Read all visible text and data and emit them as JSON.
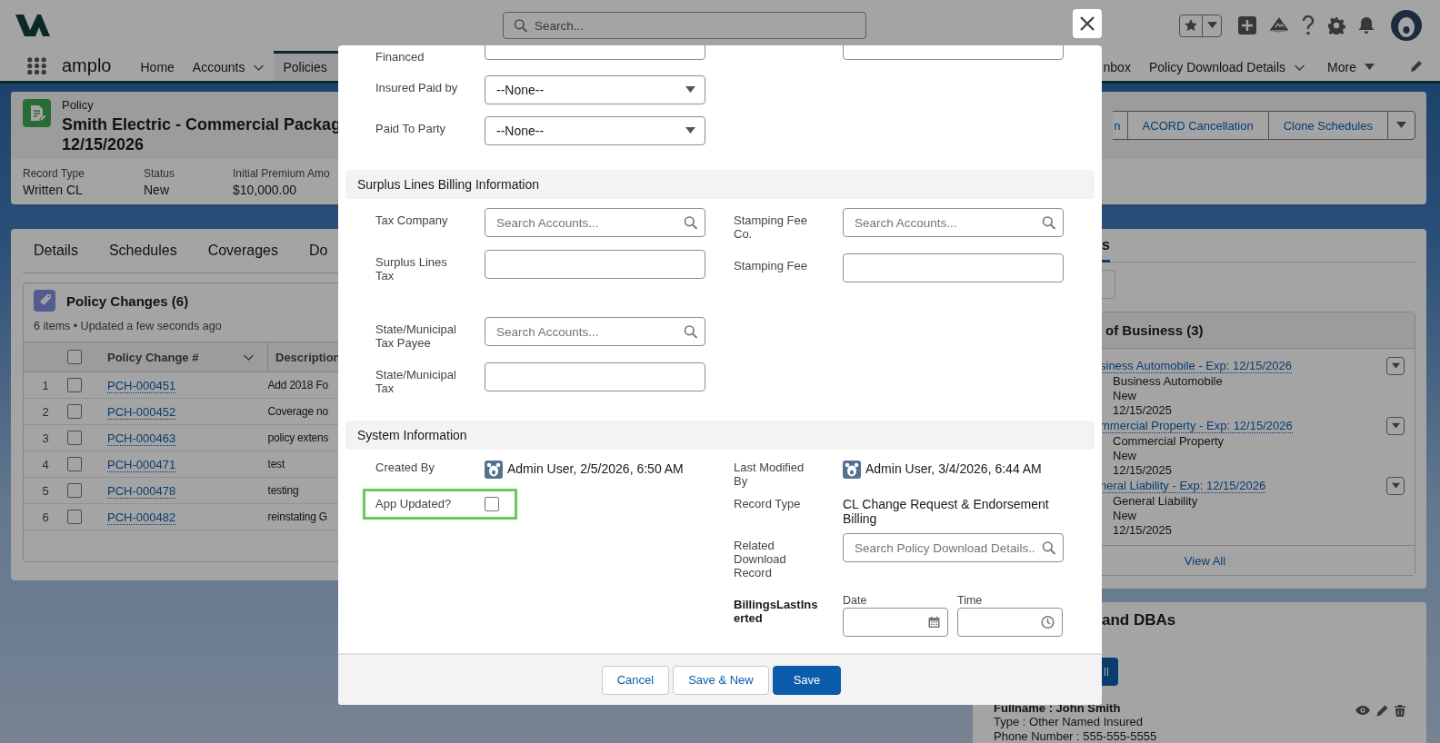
{
  "header": {
    "search_placeholder": "Search..."
  },
  "nav": {
    "app_name": "amplo",
    "items": [
      {
        "label": "Home",
        "kind": "plain",
        "selected": false
      },
      {
        "label": "Accounts",
        "kind": "chevron",
        "selected": false
      },
      {
        "label": "Policies",
        "kind": "plain",
        "selected": true
      }
    ],
    "items_right": [
      {
        "label": "nbox",
        "kind": "plain",
        "selected": false
      },
      {
        "label": "Policy Download Details",
        "kind": "chevron",
        "selected": false
      },
      {
        "label": "More",
        "kind": "triangle",
        "selected": false
      }
    ]
  },
  "record": {
    "object_label": "Policy",
    "title": "Smith Electric - Commercial Packag",
    "date": "12/15/2026",
    "actions": [
      "n",
      "ACORD Cancellation",
      "Clone Schedules"
    ],
    "fields": [
      {
        "label": "Record Type",
        "value": "Written CL"
      },
      {
        "label": "Status",
        "value": "New"
      },
      {
        "label": "Initial Premium Amo",
        "value": "$10,000.00"
      }
    ]
  },
  "tabs": [
    "Details",
    "Schedules",
    "Coverages",
    "Do"
  ],
  "related": {
    "title": "Policy Changes (6)",
    "meta": "6 items • Updated a few seconds ago",
    "all_selected": false,
    "columns": [
      {
        "label": "Policy Change #",
        "menu": true
      },
      {
        "label": "Description"
      }
    ],
    "rows": [
      {
        "number": "1",
        "id": "PCH-000451",
        "description": "Add 2018 Fo",
        "selected": false
      },
      {
        "number": "2",
        "id": "PCH-000452",
        "description": "Coverage no",
        "selected": false
      },
      {
        "number": "3",
        "id": "PCH-000463",
        "description": "policy extens",
        "selected": false
      },
      {
        "number": "4",
        "id": "PCH-000471",
        "description": "test",
        "selected": false
      },
      {
        "number": "5",
        "id": "PCH-000478",
        "description": "testing",
        "selected": false
      },
      {
        "number": "6",
        "id": "PCH-000482",
        "description": "reinstating G",
        "selected": false
      }
    ]
  },
  "side": {
    "tabs": [
      {
        "label": "s",
        "selected": true
      }
    ],
    "lines": {
      "title": "of Business (3)",
      "footer_link": "View All",
      "items": [
        {
          "link": "siness Automobile - Exp: 12/15/2026",
          "details": [
            "Business Automobile",
            "New",
            "12/15/2025"
          ]
        },
        {
          "link": "mmercial Property - Exp: 12/15/2026",
          "details": [
            "Commercial Property",
            "New",
            "12/15/2025"
          ]
        },
        {
          "link": "neral Liability - Exp: 12/15/2026",
          "details": [
            "General Liability",
            "New",
            "12/15/2025"
          ]
        }
      ]
    },
    "dbas": {
      "title": "and DBAs",
      "button": "ll",
      "contacts": [
        {
          "name": "Fullname : John Smith",
          "lines": [
            "Type : Other Named Insured",
            "Phone Number : 555-555-5555"
          ]
        }
      ]
    }
  },
  "modal": {
    "sections": [
      {
        "left": [
          {
            "label": "Financed",
            "kind": "text"
          },
          {
            "label": "Insured Paid by",
            "kind": "select",
            "value": "--None--"
          },
          {
            "label": "Paid To Party",
            "kind": "select",
            "value": "--None--"
          }
        ],
        "right": [
          {
            "kind": "text"
          }
        ]
      },
      {
        "title": "Surplus Lines Billing Information",
        "left": [
          {
            "label": "Tax Company",
            "kind": "lookup",
            "placeholder": "Search Accounts..."
          },
          {
            "label": "Surplus Lines Tax",
            "kind": "text"
          },
          {
            "label": "State/Municipal Tax Payee",
            "kind": "lookup",
            "placeholder": "Search Accounts..."
          },
          {
            "label": "State/Municipal Tax",
            "kind": "text"
          }
        ],
        "right": [
          {
            "label": "Stamping Fee Co.",
            "kind": "lookup",
            "placeholder": "Search Accounts..."
          },
          {
            "label": "Stamping Fee",
            "kind": "text"
          }
        ]
      },
      {
        "title": "System Information",
        "left": [
          {
            "label": "Created By",
            "kind": "user",
            "value": "Admin User, 2/5/2026, 6:50 AM"
          },
          {
            "label": "App Updated?",
            "kind": "checkbox",
            "checked": false,
            "highlighted": true
          }
        ],
        "right": [
          {
            "label": "Last Modified By",
            "kind": "user",
            "value": "Admin User, 3/4/2026, 6:44 AM"
          },
          {
            "label": "Record Type",
            "kind": "readonly",
            "value": "CL Change Request & Endorsement Billing"
          },
          {
            "label": "Related Download Record",
            "kind": "lookup",
            "placeholder": "Search Policy Download Details.."
          },
          {
            "label": "BillingsLastInserted",
            "kind": "datetime",
            "date_label": "Date",
            "time_label": "Time"
          }
        ]
      }
    ],
    "footer": [
      {
        "label": "Cancel",
        "kind": "neutral"
      },
      {
        "label": "Save & New",
        "kind": "neutral"
      },
      {
        "label": "Save",
        "kind": "brand"
      }
    ]
  }
}
